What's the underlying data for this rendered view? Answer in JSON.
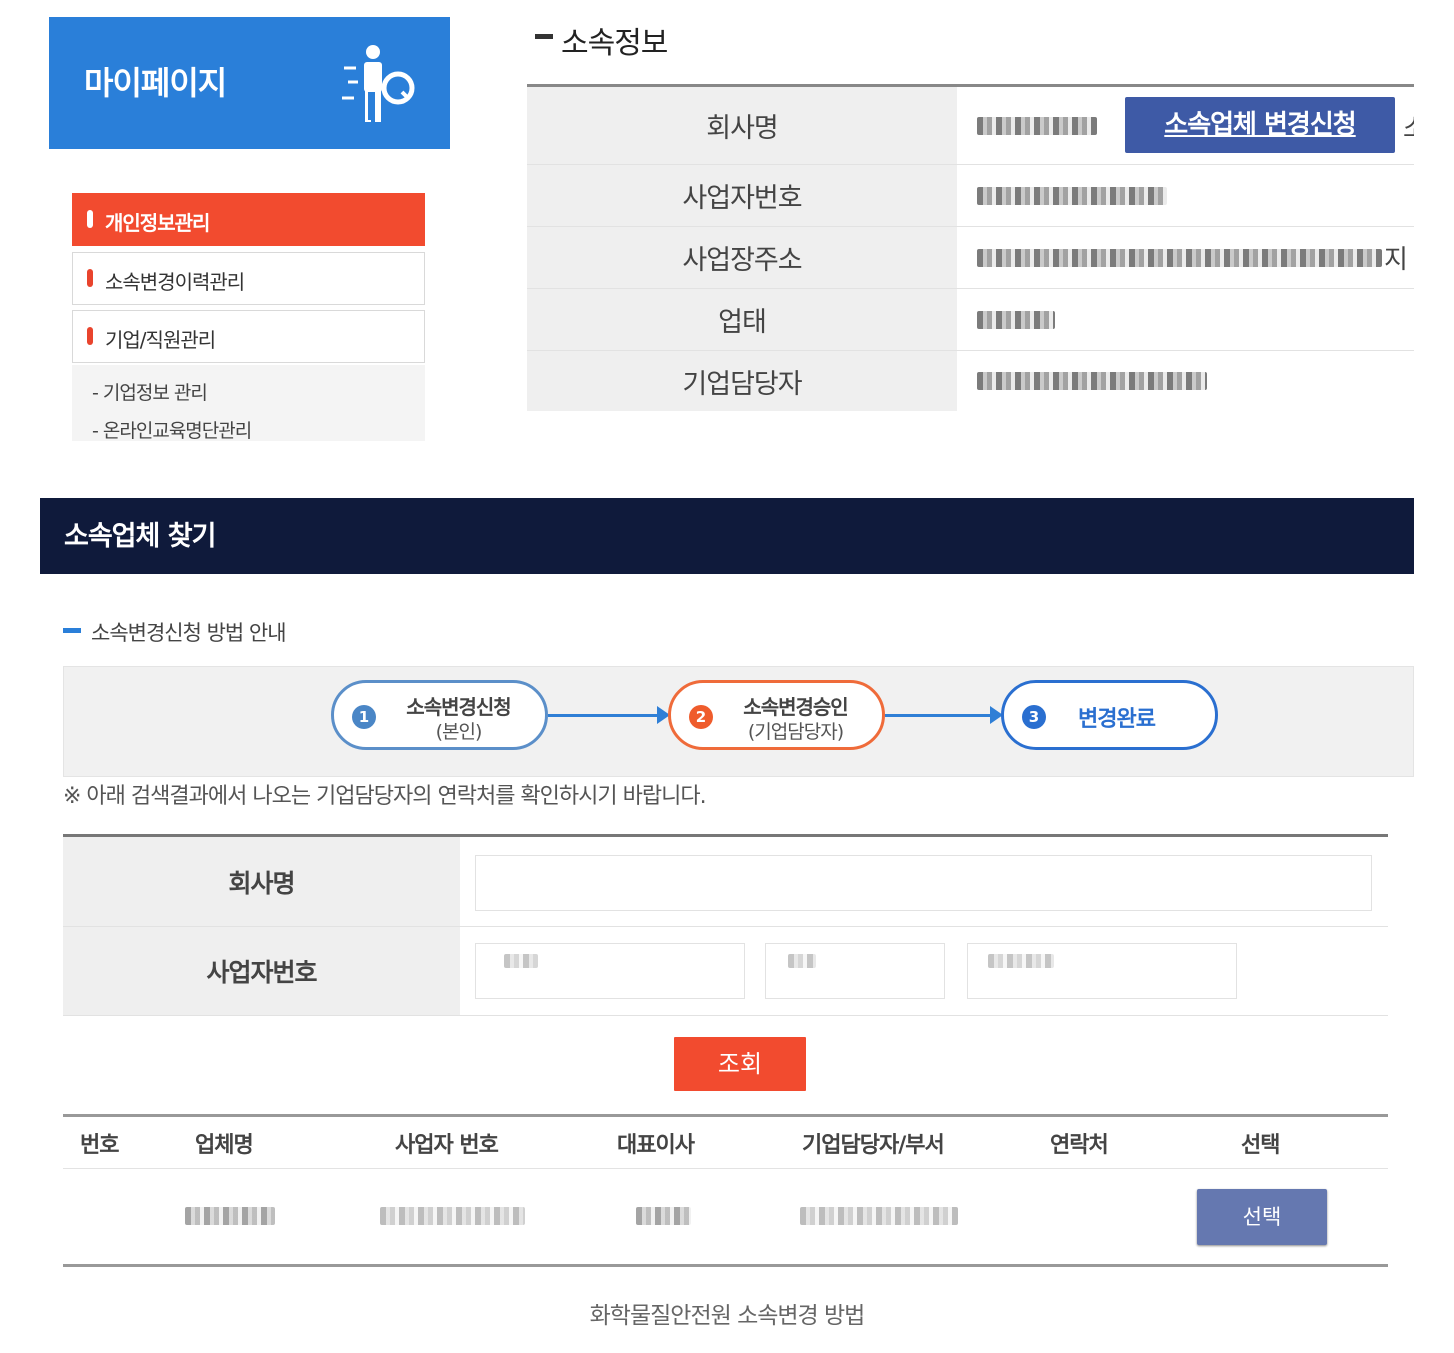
{
  "mypage": {
    "title": "마이페이지"
  },
  "sidebar": {
    "items": [
      {
        "label": "개인정보관리",
        "active": true
      },
      {
        "label": "소속변경이력관리",
        "active": false
      },
      {
        "label": "기업/직원관리",
        "active": false
      }
    ],
    "subitems": [
      {
        "label": "- 기업정보 관리"
      },
      {
        "label": "- 온라인교육명단관리"
      }
    ]
  },
  "affiliation_info": {
    "heading": "소속정보",
    "rows": [
      {
        "label": "회사명"
      },
      {
        "label": "사업자번호"
      },
      {
        "label": "사업장주소"
      },
      {
        "label": "업태"
      },
      {
        "label": "기업담당자"
      }
    ],
    "change_request_button": "소속업체 변경신청",
    "address_tail": "지",
    "cut_glyph": "소"
  },
  "find_company": {
    "title": "소속업체 찾기",
    "guide_title": "소속변경신청 방법 안내",
    "steps": [
      {
        "num": "1",
        "line1": "소속변경신청",
        "line2": "(본인)"
      },
      {
        "num": "2",
        "line1": "소속변경승인",
        "line2": "(기업담당자)"
      },
      {
        "num": "3",
        "line1": "변경완료",
        "line2": ""
      }
    ],
    "notice": "※ 아래 검색결과에서 나오는 기업담당자의 연락처를 확인하시기 바랍니다.",
    "form": {
      "company_label": "회사명",
      "bizno_label": "사업자번호"
    },
    "search_button": "조회",
    "table": {
      "headers": [
        "번호",
        "업체명",
        "사업자 번호",
        "대표이사",
        "기업담당자/부서",
        "연락처",
        "선택"
      ],
      "select_button": "선택"
    }
  },
  "caption": "화학물질안전원 소속변경 방법",
  "colors": {
    "brand_blue": "#2a7fd9",
    "accent_red": "#f24b2f",
    "header_navy": "#0f1a3b",
    "button_indigo": "#3e5aa6"
  }
}
